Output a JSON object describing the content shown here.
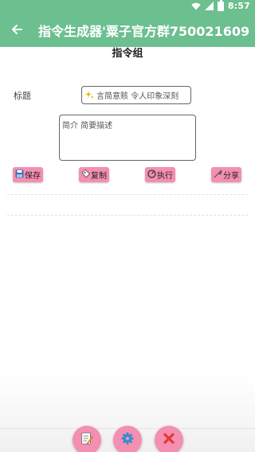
{
  "status_bar": {
    "time": "8:57",
    "icons": [
      "wifi-icon",
      "signal-icon",
      "battery-icon"
    ]
  },
  "app_bar": {
    "title": "指令生成器'粟子官方群750021609",
    "back_icon": "arrow-left-icon"
  },
  "page": {
    "title": "指令组"
  },
  "form": {
    "title_label": "标题",
    "title_placeholder": "言简意赅 令人印象深刻",
    "description_placeholder": "简介 简要描述"
  },
  "actions": [
    {
      "label": "保存",
      "icon": "floppy-icon"
    },
    {
      "label": "复制",
      "icon": "copy-icon"
    },
    {
      "label": "执行",
      "icon": "run-icon"
    },
    {
      "label": "分享",
      "icon": "share-icon"
    }
  ],
  "bottom_bar": {
    "buttons": [
      "edit-note-icon",
      "settings-gear-icon",
      "close-x-icon"
    ]
  },
  "colors": {
    "primary": "#6cbf8f",
    "accent_pink": "#f48fb1",
    "close_red": "#e53935"
  }
}
